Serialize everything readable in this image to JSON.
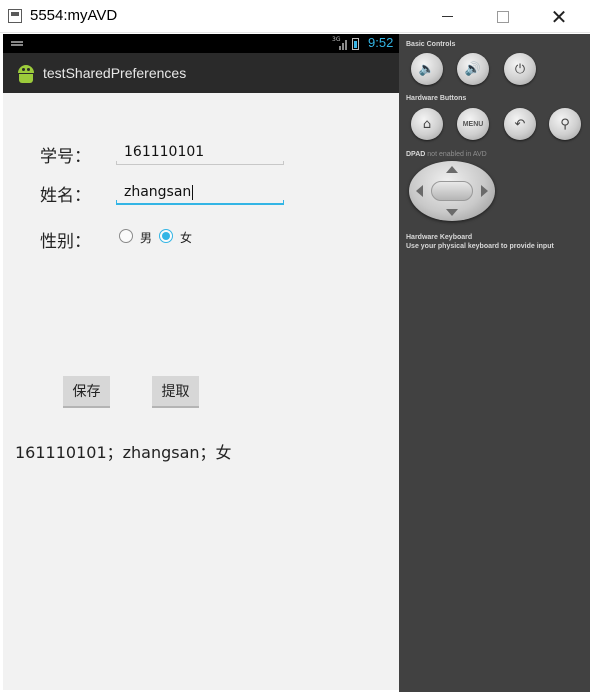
{
  "window": {
    "title": "5554:myAVD",
    "minimize_glyph": "",
    "maximize_glyph": "",
    "close_glyph": "✕"
  },
  "statusbar": {
    "network_label": "3G",
    "time": "9:52",
    "accent_color": "#33b5e5"
  },
  "actionbar": {
    "app_name": "testSharedPreferences",
    "icon": "android-icon"
  },
  "form": {
    "id_label": "学号：",
    "id_value": "161110101",
    "name_label": "姓名：",
    "name_value": "zhangsan",
    "gender_label": "性别：",
    "gender_options": [
      {
        "label": "男",
        "selected": false
      },
      {
        "label": "女",
        "selected": true
      }
    ]
  },
  "buttons": {
    "save_label": "保存",
    "fetch_label": "提取"
  },
  "result_text": "161110101；zhangsan；女",
  "controls": {
    "basic_heading": "Basic Controls",
    "basic_buttons": [
      "volume-down-icon",
      "volume-up-icon",
      "power-icon"
    ],
    "hardware_heading": "Hardware Buttons",
    "hardware_buttons": [
      "home-icon",
      "menu-button",
      "back-icon",
      "search-icon"
    ],
    "menu_label": "MENU",
    "dpad_heading": "DPAD",
    "dpad_note": "not enabled in AVD",
    "keyboard_heading": "Hardware Keyboard",
    "keyboard_note": "Use your physical keyboard to provide input"
  }
}
